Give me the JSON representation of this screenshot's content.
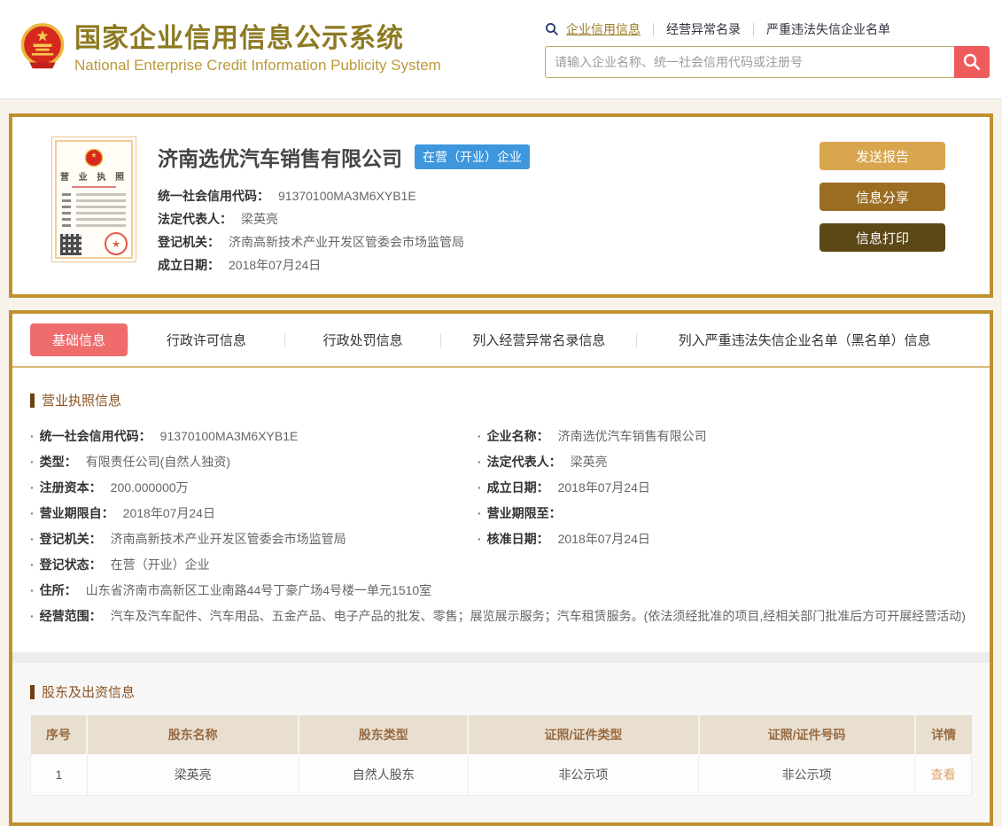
{
  "colors": {
    "accent_gold_border": "#c0902f",
    "title_gold": "#8d7a22",
    "search_button_red": "#ef5b5b",
    "active_tab_red": "#ef6c6c",
    "status_badge_blue": "#3e97dd",
    "button_send": "#d9a54e",
    "button_share": "#9a6d22",
    "button_print": "#5c4717",
    "view_link": "#dca46a"
  },
  "header": {
    "title": "国家企业信用信息公示系统",
    "subtitle": "National Enterprise Credit Information Publicity System",
    "nav": [
      {
        "label": "企业信用信息"
      },
      {
        "label": "经营异常名录"
      },
      {
        "label": "严重违法失信企业名单"
      }
    ],
    "search_placeholder": "请输入企业名称、统一社会信用代码或注册号"
  },
  "company": {
    "name": "济南选优汽车销售有限公司",
    "status": "在营（开业）企业",
    "license_label": "营 业 执 照",
    "fields": [
      {
        "label": "统一社会信用代码：",
        "value": "91370100MA3M6XYB1E"
      },
      {
        "label": "法定代表人：",
        "value": "梁英亮"
      },
      {
        "label": "登记机关：",
        "value": "济南高新技术产业开发区管委会市场监管局"
      },
      {
        "label": "成立日期：",
        "value": "2018年07月24日"
      }
    ],
    "buttons": [
      {
        "label": "发送报告"
      },
      {
        "label": "信息分享"
      },
      {
        "label": "信息打印"
      }
    ]
  },
  "tabs": [
    {
      "label": "基础信息",
      "active": true
    },
    {
      "label": "行政许可信息",
      "active": false
    },
    {
      "label": "行政处罚信息",
      "active": false
    },
    {
      "label": "列入经营异常名录信息",
      "active": false
    },
    {
      "label": "列入严重违法失信企业名单（黑名单）信息",
      "active": false
    }
  ],
  "license_info": {
    "title": "营业执照信息",
    "left": [
      {
        "label": "统一社会信用代码：",
        "value": "91370100MA3M6XYB1E"
      },
      {
        "label": "类型：",
        "value": "有限责任公司(自然人独资)"
      },
      {
        "label": "注册资本：",
        "value": "200.000000万"
      },
      {
        "label": "营业期限自：",
        "value": "2018年07月24日"
      },
      {
        "label": "登记机关：",
        "value": "济南高新技术产业开发区管委会市场监管局"
      },
      {
        "label": "登记状态：",
        "value": "在营（开业）企业"
      }
    ],
    "right": [
      {
        "label": "企业名称：",
        "value": "济南选优汽车销售有限公司"
      },
      {
        "label": "法定代表人：",
        "value": "梁英亮"
      },
      {
        "label": "成立日期：",
        "value": "2018年07月24日"
      },
      {
        "label": "营业期限至：",
        "value": ""
      },
      {
        "label": "核准日期：",
        "value": "2018年07月24日"
      }
    ],
    "full": [
      {
        "label": "住所：",
        "value": "山东省济南市高新区工业南路44号丁豪广场4号楼一单元1510室"
      },
      {
        "label": "经营范围：",
        "value": "汽车及汽车配件、汽车用品、五金产品、电子产品的批发、零售；展览展示服务；汽车租赁服务。(依法须经批准的项目,经相关部门批准后方可开展经营活动)"
      }
    ]
  },
  "shareholders": {
    "title": "股东及出资信息",
    "headers": [
      "序号",
      "股东名称",
      "股东类型",
      "证照/证件类型",
      "证照/证件号码",
      "详情"
    ],
    "rows": [
      {
        "cells": [
          "1",
          "梁英亮",
          "自然人股东",
          "非公示项",
          "非公示项"
        ],
        "action": "查看"
      }
    ]
  }
}
